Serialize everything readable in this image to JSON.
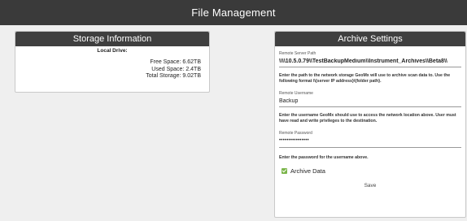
{
  "header": {
    "title": "File Management"
  },
  "storage": {
    "title": "Storage Information",
    "drive_label": "Local Drive:",
    "free_space": "Free Space: 6.62TB",
    "used_space": "Used Space: 2.4TB",
    "total_storage": "Total Storage: 9.02TB"
  },
  "archive": {
    "title": "Archive Settings",
    "server_path_label": "Remote Server Path",
    "server_path_value": "\\\\\\\\10.5.0.79\\\\TestBackupMedium\\\\Instrument_Archives\\\\Beta8\\\\",
    "server_path_hint": "Enter the path to the network storage GeoMx will use to archive scan data to. Use the following format \\\\{server IP address}\\{folder path}.",
    "username_label": "Remote Username",
    "username_value": "Backup",
    "username_hint": "Enter the username GeoMx should use to access the network location above. User must have read and write privileges to the destination.",
    "password_label": "Remote Password",
    "password_value": "••••••••••••••••",
    "password_hint": "Enter the password for the username above.",
    "archive_data_label": "Archive Data",
    "archive_data_checked": true,
    "save_label": "Save"
  },
  "colors": {
    "header_bg": "#3a3a3a",
    "panel_header_bg": "#3f3f3f",
    "checkbox": "#7bb54a"
  }
}
